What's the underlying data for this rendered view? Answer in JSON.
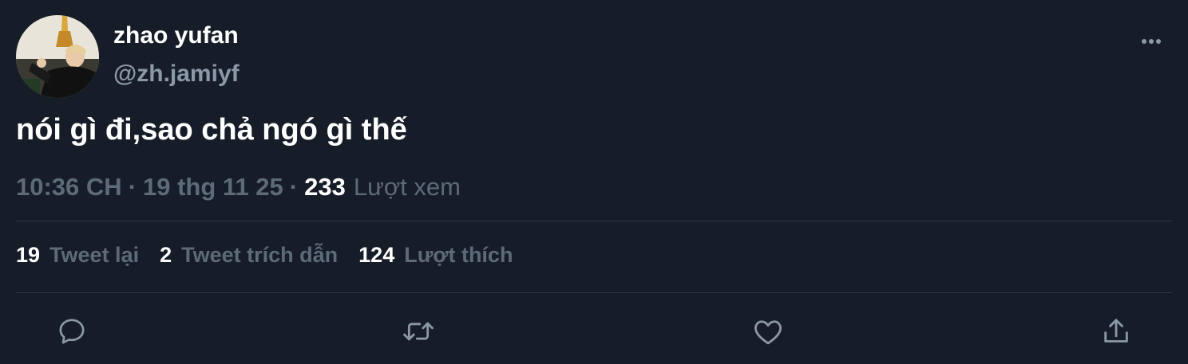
{
  "author": {
    "name": "zhao yufan",
    "handle": "@zh.jamiyf"
  },
  "tweet": {
    "text": "nói gì đi,sao chả ngó gì thế"
  },
  "meta": {
    "time": "10:36 CH",
    "separator": "·",
    "date": "19 thg 11 25",
    "views_count": "233",
    "views_label": "Lượt xem"
  },
  "stats": {
    "retweets_count": "19",
    "retweets_label": "Tweet lại",
    "quotes_count": "2",
    "quotes_label": "Tweet trích dẫn",
    "likes_count": "124",
    "likes_label": "Lượt thích"
  },
  "icons": {
    "more": "more-horizontal-icon",
    "reply": "reply-bubble-icon",
    "retweet": "retweet-arrows-icon",
    "like": "heart-icon",
    "share": "share-upload-icon"
  },
  "colors": {
    "background": "#161d29",
    "primary_text": "#ffffff",
    "secondary_text": "#5d6a78",
    "handle_text": "#8b98a5",
    "divider": "#2f3742"
  }
}
